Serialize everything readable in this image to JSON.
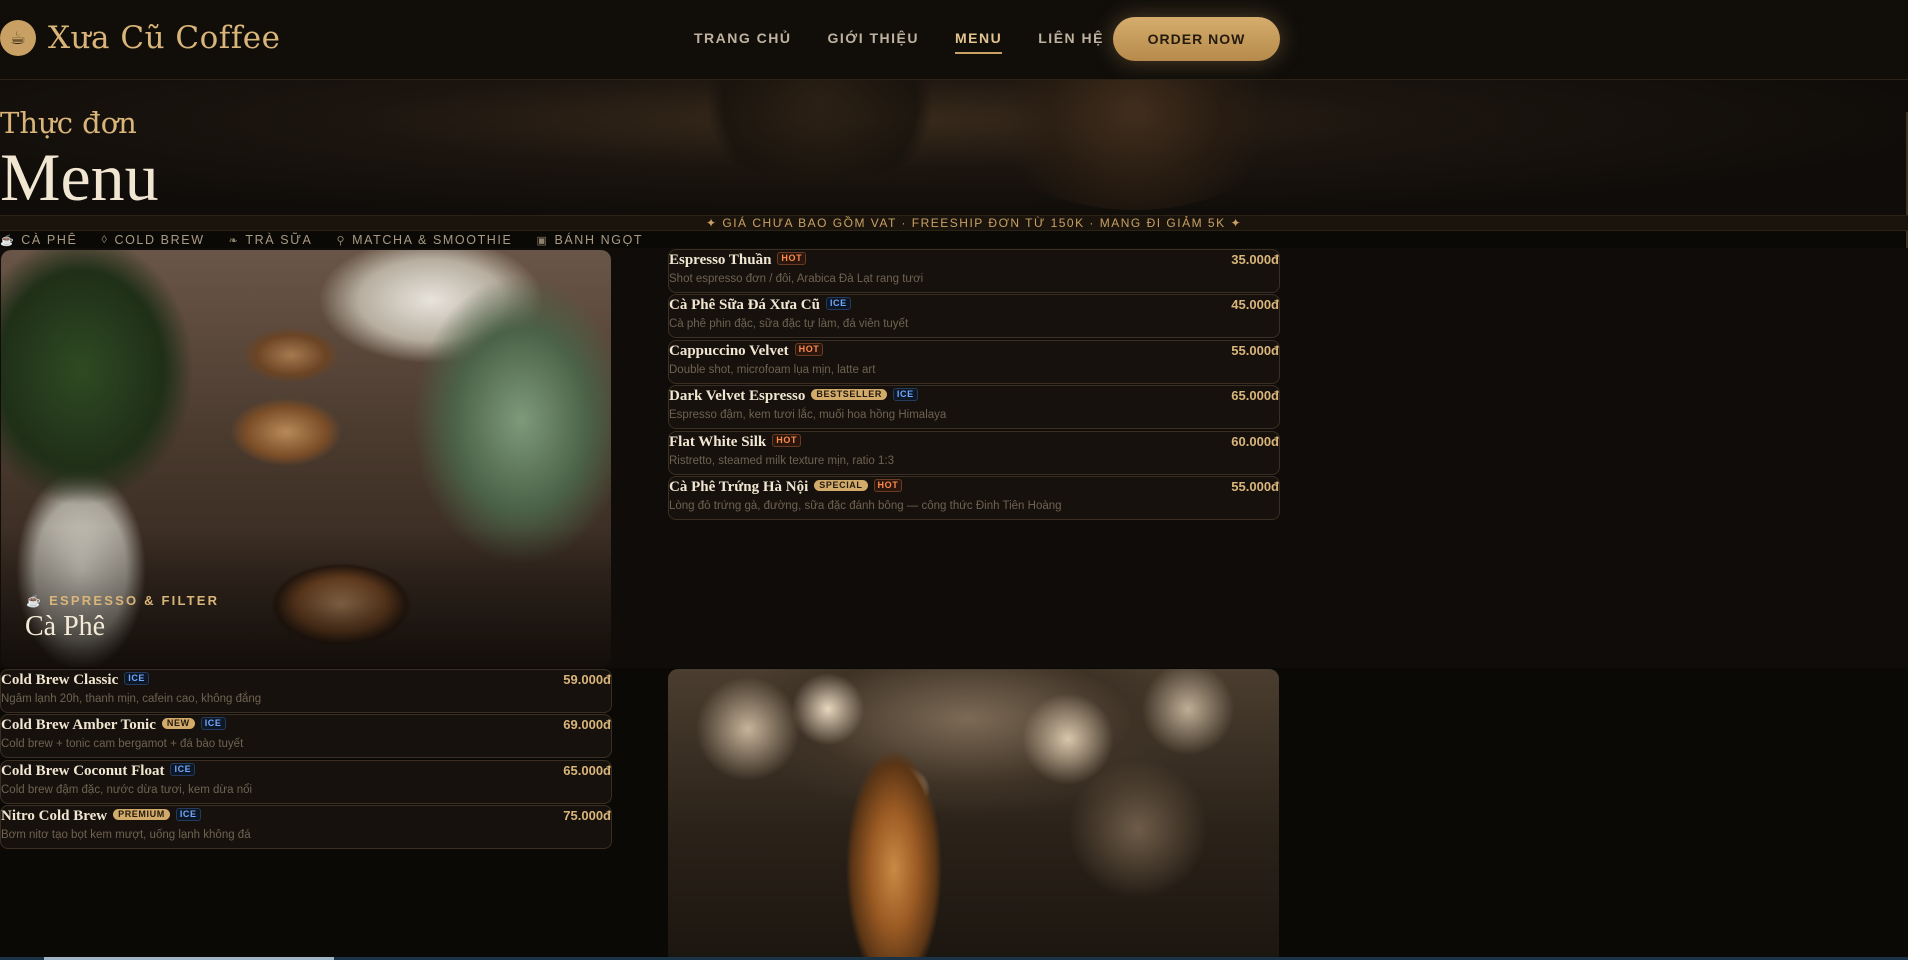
{
  "brand": {
    "name": "Xưa Cũ Coffee",
    "logo_icon": "coffee-bean-icon"
  },
  "nav": {
    "links": [
      {
        "label": "TRANG CHỦ",
        "active": false
      },
      {
        "label": "GIỚI THIỆU",
        "active": false
      },
      {
        "label": "MENU",
        "active": true
      },
      {
        "label": "LIÊN HỆ",
        "active": false
      }
    ],
    "cta": "ORDER NOW"
  },
  "hero": {
    "subtitle": "Thực đơn",
    "title": "Menu"
  },
  "notice": "✦ GIÁ CHƯA BAO GỒM VAT · FREESHIP ĐƠN TỪ 150K · MANG ĐI GIẢM 5K ✦",
  "categories": [
    {
      "icon": "cup-icon",
      "label": "CÀ PHÊ"
    },
    {
      "icon": "drop-icon",
      "label": "COLD BREW"
    },
    {
      "icon": "leaf-icon",
      "label": "TRÀ SỮA"
    },
    {
      "icon": "pin-icon",
      "label": "MATCHA & SMOOTHIE"
    },
    {
      "icon": "cake-icon",
      "label": "BÁNH NGỌT"
    }
  ],
  "coffee_card": {
    "kicker": "ESPRESSO & FILTER",
    "title": "Cà Phê",
    "kicker_icon": "cup-icon"
  },
  "coffee_items": [
    {
      "name": "Espresso Thuần",
      "tags": [
        "HOT"
      ],
      "desc": "Shot espresso đơn / đôi, Arabica Đà Lạt rang tươi",
      "price": "35.000đ"
    },
    {
      "name": "Cà Phê Sữa Đá Xưa Cũ",
      "tags": [
        "ICE"
      ],
      "desc": "Cà phê phin đặc, sữa đặc tự làm, đá viên tuyết",
      "price": "45.000đ"
    },
    {
      "name": "Cappuccino Velvet",
      "tags": [
        "HOT"
      ],
      "desc": "Double shot, microfoam lụa mịn, latte art",
      "price": "55.000đ"
    },
    {
      "name": "Dark Velvet Espresso",
      "tags": [
        "BESTSELLER",
        "ICE"
      ],
      "desc": "Espresso đậm, kem tươi lắc, muối hoa hồng Himalaya",
      "price": "65.000đ"
    },
    {
      "name": "Flat White Silk",
      "tags": [
        "HOT"
      ],
      "desc": "Ristretto, steamed milk texture mịn, ratio 1:3",
      "price": "60.000đ"
    },
    {
      "name": "Cà Phê Trứng Hà Nội",
      "tags": [
        "SPECIAL",
        "HOT"
      ],
      "desc": "Lòng đỏ trứng gà, đường, sữa đặc đánh bông — công thức Đinh Tiên Hoàng",
      "price": "55.000đ"
    }
  ],
  "coldbrew_items": [
    {
      "name": "Cold Brew Classic",
      "tags": [
        "ICE"
      ],
      "desc": "Ngâm lạnh 20h, thanh mịn, cafein cao, không đắng",
      "price": "59.000đ"
    },
    {
      "name": "Cold Brew Amber Tonic",
      "tags": [
        "NEW",
        "ICE"
      ],
      "desc": "Cold brew + tonic cam bergamot + đá bào tuyết",
      "price": "69.000đ"
    },
    {
      "name": "Cold Brew Coconut Float",
      "tags": [
        "ICE"
      ],
      "desc": "Cold brew đậm đặc, nước dừa tươi, kem dừa nổi",
      "price": "65.000đ"
    },
    {
      "name": "Nitro Cold Brew",
      "tags": [
        "PREMIUM",
        "ICE"
      ],
      "desc": "Bơm nitơ tạo bọt kem mượt, uống lạnh không đá",
      "price": "75.000đ"
    }
  ],
  "colors": {
    "gold": "#d9b57a",
    "background": "#0b0906",
    "hot": "#ff8a4c",
    "ice": "#6fa8ff"
  }
}
